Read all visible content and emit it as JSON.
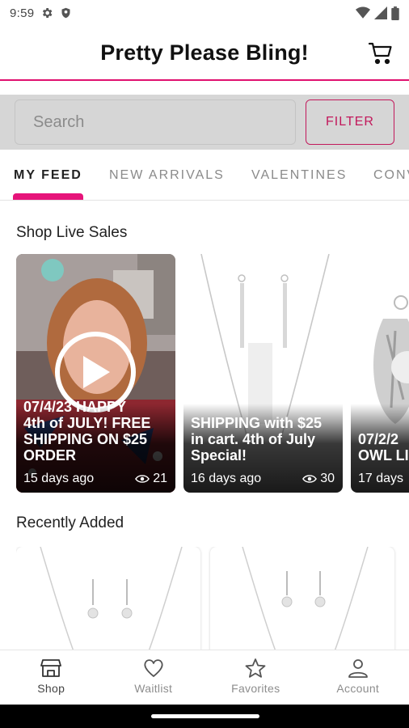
{
  "status_bar": {
    "time": "9:59",
    "left_icons": [
      "gear-icon",
      "shield-icon"
    ],
    "right_icons": [
      "wifi-icon",
      "cellular-signal-icon",
      "battery-icon"
    ]
  },
  "header": {
    "title": "Pretty Please Bling!",
    "cart_icon": "cart-icon"
  },
  "search": {
    "placeholder": "Search",
    "value": "",
    "filter_label": "FILTER"
  },
  "tabs": [
    {
      "label": "MY FEED",
      "active": true
    },
    {
      "label": "NEW ARRIVALS",
      "active": false
    },
    {
      "label": "VALENTINES",
      "active": false
    },
    {
      "label": "CONV",
      "active": false
    }
  ],
  "live_sales": {
    "heading": "Shop Live Sales",
    "cards": [
      {
        "caption": "07/4/23 HAPPY\n4th of JULY! FREE\nSHIPPING ON $25\nORDER",
        "age": "15 days ago",
        "views": "21",
        "has_play": true
      },
      {
        "caption": "SHIPPING with $25\nin cart. 4th of July\nSpecial!",
        "age": "16 days ago",
        "views": "30",
        "has_play": false
      },
      {
        "caption": "07/2/2\nOWL LI",
        "age": "17 days",
        "views": "",
        "has_play": false
      }
    ]
  },
  "recently_added": {
    "heading": "Recently Added"
  },
  "bottom_nav": [
    {
      "label": "Shop",
      "icon": "store-icon",
      "active": true
    },
    {
      "label": "Waitlist",
      "icon": "heart-icon",
      "active": false
    },
    {
      "label": "Favorites",
      "icon": "star-icon",
      "active": false
    },
    {
      "label": "Account",
      "icon": "person-icon",
      "active": false
    }
  ],
  "colors": {
    "accent": "#e6147a",
    "filter_border": "#c2185b",
    "search_band": "#d6d6d6"
  }
}
